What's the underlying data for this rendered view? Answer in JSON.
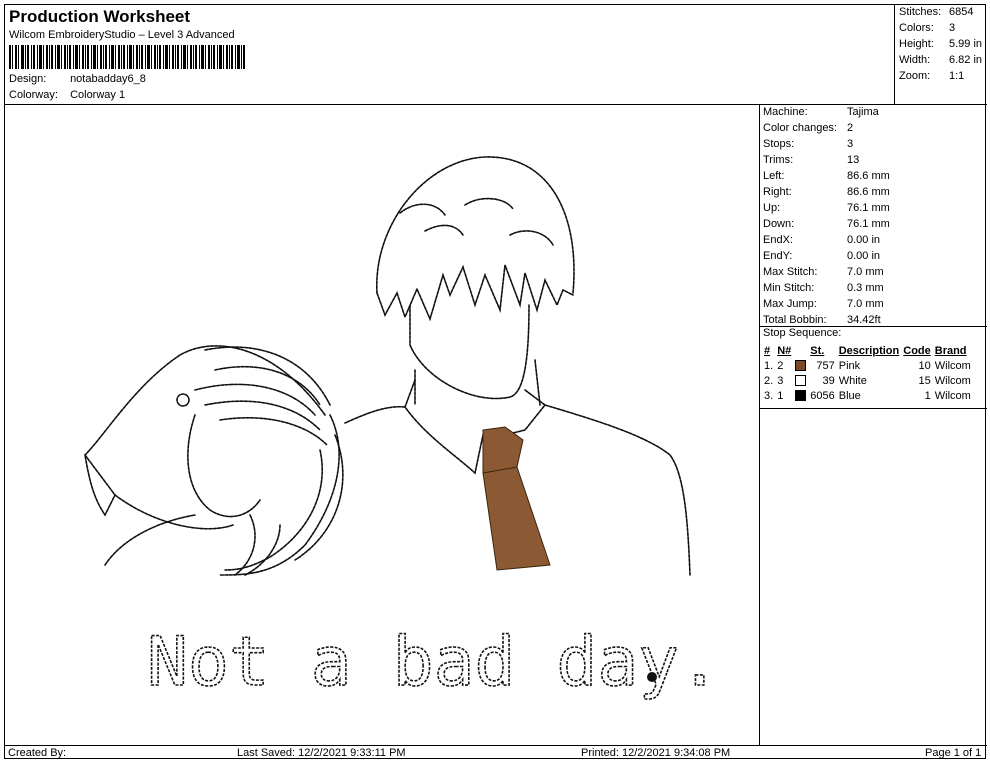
{
  "header": {
    "title": "Production Worksheet",
    "software": "Wilcom EmbroideryStudio – Level 3 Advanced",
    "design_label": "Design:",
    "design_value": "notabadday6_8",
    "colorway_label": "Colorway:",
    "colorway_value": "Colorway 1"
  },
  "stats": [
    {
      "label": "Stitches:",
      "value": "6854"
    },
    {
      "label": "Colors:",
      "value": "3"
    },
    {
      "label": "Height:",
      "value": "5.99 in"
    },
    {
      "label": "Width:",
      "value": "6.82 in"
    },
    {
      "label": "Zoom:",
      "value": "1:1"
    }
  ],
  "machine": [
    {
      "label": "Machine:",
      "value": "Tajima"
    },
    {
      "label": "Color changes:",
      "value": "2"
    },
    {
      "label": "Stops:",
      "value": "3"
    },
    {
      "label": "Trims:",
      "value": "13"
    },
    {
      "label": "Left:",
      "value": "86.6 mm"
    },
    {
      "label": "Right:",
      "value": "86.6 mm"
    },
    {
      "label": "Up:",
      "value": "76.1 mm"
    },
    {
      "label": "Down:",
      "value": "76.1 mm"
    },
    {
      "label": "EndX:",
      "value": "0.00 in"
    },
    {
      "label": "EndY:",
      "value": "0.00 in"
    },
    {
      "label": "Max Stitch:",
      "value": "7.0 mm"
    },
    {
      "label": "Min Stitch:",
      "value": "0.3 mm"
    },
    {
      "label": "Max Jump:",
      "value": "7.0 mm"
    },
    {
      "label": "Total Bobbin:",
      "value": "34.42ft"
    }
  ],
  "stop_sequence": {
    "title": "Stop Sequence:",
    "headers": {
      "idx": "#",
      "n": "N#",
      "st": "St.",
      "desc": "Description",
      "code": "Code",
      "brand": "Brand"
    },
    "rows": [
      {
        "idx": "1.",
        "n": "2",
        "color": "#7a4a28",
        "st": "757",
        "desc": "Pink",
        "code": "10",
        "brand": "Wilcom"
      },
      {
        "idx": "2.",
        "n": "3",
        "color": "#ffffff",
        "st": "39",
        "desc": "White",
        "code": "15",
        "brand": "Wilcom"
      },
      {
        "idx": "3.",
        "n": "1",
        "color": "#000000",
        "st": "6056",
        "desc": "Blue",
        "code": "1",
        "brand": "Wilcom"
      }
    ]
  },
  "design_text": "Not a bad day.",
  "colors": {
    "tie": "#8b5a34",
    "stitch": "#111111"
  },
  "footer": {
    "created": "Created By:",
    "saved": "Last Saved: 12/2/2021 9:33:11 PM",
    "printed": "Printed: 12/2/2021 9:34:08 PM",
    "page": "Page 1 of 1"
  }
}
